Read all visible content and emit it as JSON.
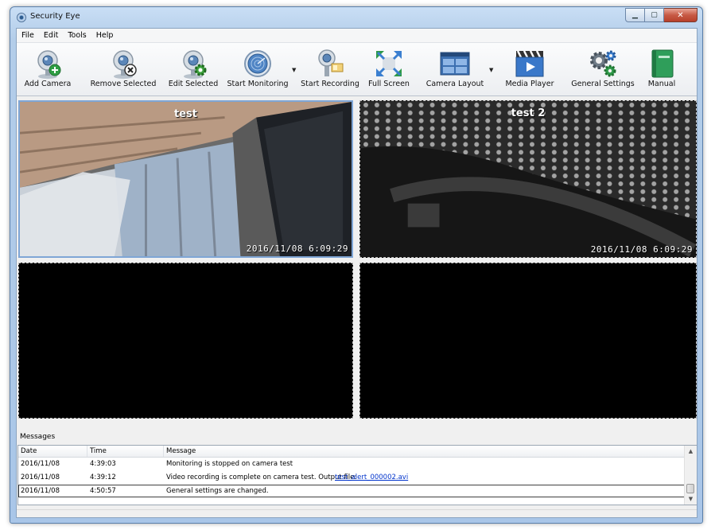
{
  "window": {
    "title": "Security Eye",
    "min_glyph": "▁",
    "max_glyph": "▢",
    "close_glyph": "✕"
  },
  "menu": [
    "File",
    "Edit",
    "Tools",
    "Help"
  ],
  "toolbar": {
    "add_camera": "Add Camera",
    "remove_selected": "Remove Selected",
    "edit_selected": "Edit Selected",
    "start_monitoring": "Start Monitoring",
    "start_recording": "Start Recording",
    "full_screen": "Full Screen",
    "camera_layout": "Camera Layout",
    "media_player": "Media Player",
    "general_settings": "General Settings",
    "manual": "Manual",
    "dropdown_glyph": "▼"
  },
  "cameras": [
    {
      "title": "test",
      "timestamp": "2016/11/08  6:09:29",
      "selected": true
    },
    {
      "title": "test 2",
      "timestamp": "2016/11/08  6:09:29",
      "selected": false
    }
  ],
  "messages": {
    "title": "Messages",
    "columns": {
      "date": "Date",
      "time": "Time",
      "message": "Message"
    },
    "rows": [
      {
        "date": "2016/11/08",
        "time": "4:39:03",
        "message": "Monitoring is stopped on camera test",
        "link": ""
      },
      {
        "date": "2016/11/08",
        "time": "4:39:12",
        "message": "Video recording is complete on camera test. Output file:",
        "link": "test_alert_000002.avi"
      },
      {
        "date": "2016/11/08",
        "time": "4:50:57",
        "message": "General settings are changed.",
        "link": ""
      }
    ],
    "scroll_up": "▲",
    "scroll_down": "▼"
  },
  "colors": {
    "accent": "#7fa6d6",
    "link": "#0033cc",
    "close": "#c75a45"
  }
}
